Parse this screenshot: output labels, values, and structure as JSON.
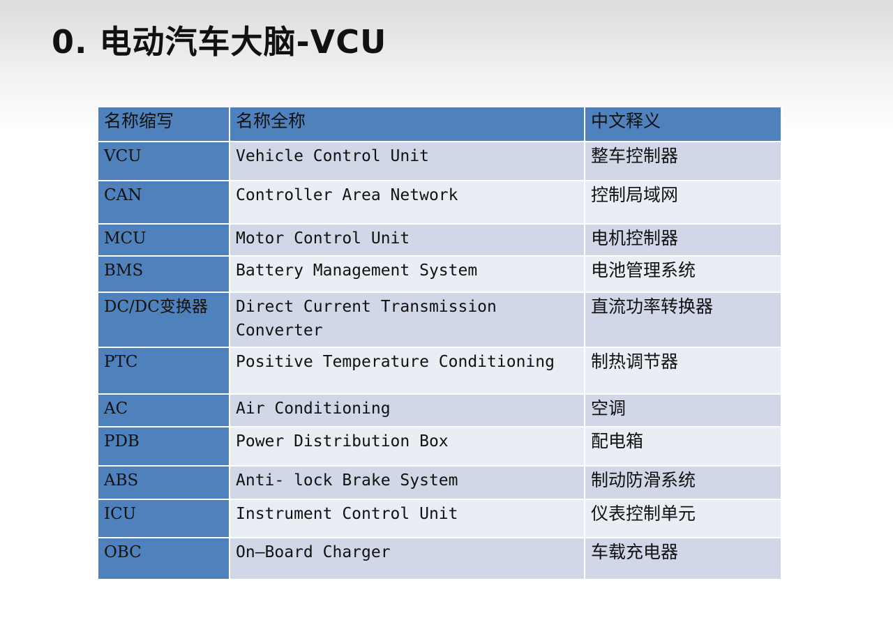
{
  "slide": {
    "title": "0. 电动汽车大脑-VCU"
  },
  "table": {
    "headers": [
      "名称缩写",
      "名称全称",
      "中文释义"
    ],
    "rows": [
      {
        "abbr": "VCU",
        "full": "Vehicle Control Unit",
        "cn": "整车控制器"
      },
      {
        "abbr": "CAN",
        "full": "Controller Area Network",
        "cn": "控制局域网"
      },
      {
        "abbr": "MCU",
        "full": "Motor Control Unit",
        "cn": "电机控制器"
      },
      {
        "abbr": "BMS",
        "full": "Battery Management  System",
        "cn": "电池管理系统"
      },
      {
        "abbr": "DC/DC变换器",
        "full": "Direct Current Transmission Converter",
        "cn": "直流功率转换器"
      },
      {
        "abbr": "PTC",
        "full": "Positive Temperature Conditioning",
        "cn": "制热调节器"
      },
      {
        "abbr": "AC",
        "full": "Air Conditioning",
        "cn": "空调"
      },
      {
        "abbr": "PDB",
        "full": "Power Distribution Box",
        "cn": "配电箱"
      },
      {
        "abbr": "ABS",
        "full": "Anti- lock Brake System",
        "cn": "制动防滑系统"
      },
      {
        "abbr": "ICU",
        "full": "Instrument Control Unit",
        "cn": "仪表控制单元"
      },
      {
        "abbr": "OBC",
        "full": "On—Board Charger",
        "cn": "车载充电器"
      }
    ]
  },
  "colors": {
    "header_bg": "#4f81bd",
    "row_odd_bg": "#d0d8e8",
    "row_even_bg": "#e9edf4"
  }
}
